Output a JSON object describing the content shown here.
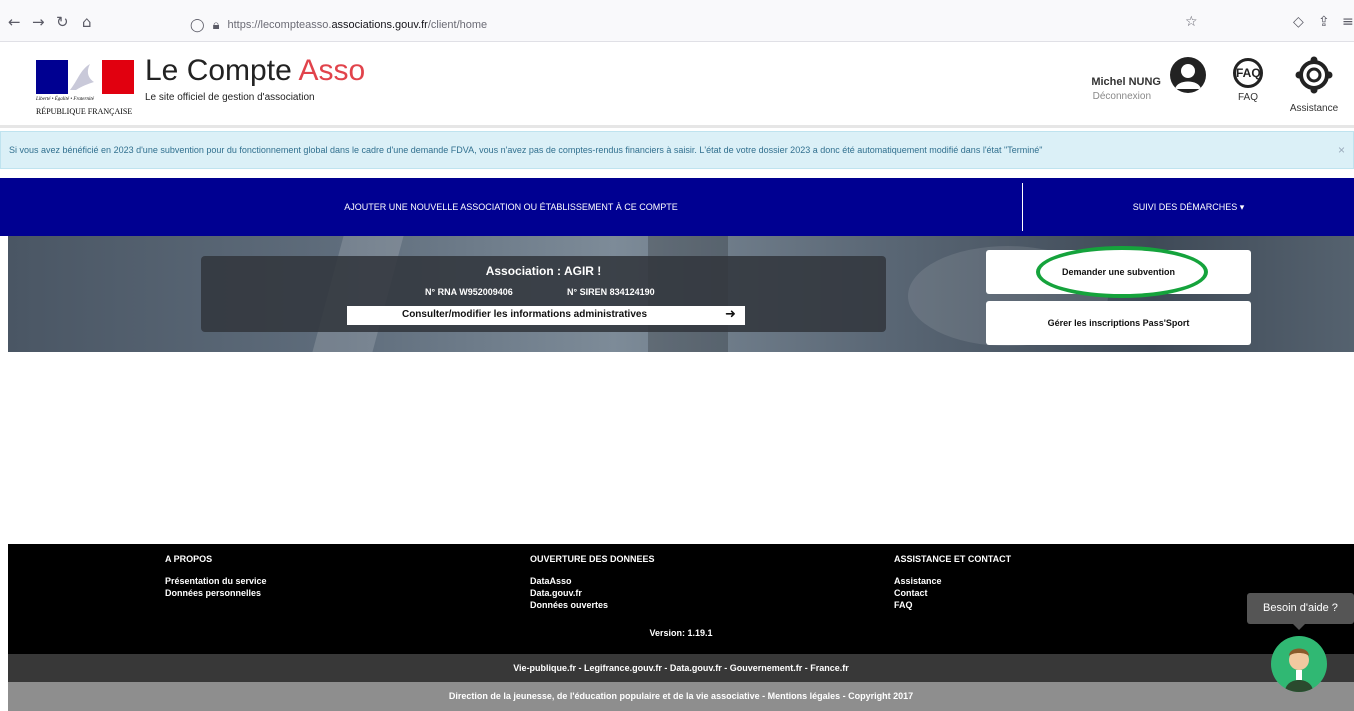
{
  "browser": {
    "url_prefix": "https://lecompteasso.",
    "url_host": "associations.gouv.fr",
    "url_path": "/client/home"
  },
  "header": {
    "flag_motto": "Liberté • Égalité • Fraternité",
    "republique": "RÉPUBLIQUE FRANÇAISE",
    "title_part1": "Le Compte ",
    "title_part2": "Asso",
    "subtitle": "Le site officiel de gestion d'association",
    "user_name": "Michel NUNG",
    "logout": "Déconnexion",
    "faq_icon_text": "FAQ",
    "faq_label": "FAQ",
    "help_label": "Assistance"
  },
  "alert": {
    "text": "Si vous avez bénéficié en 2023 d'une subvention pour du fonctionnement global dans le cadre d'une demande FDVA, vous n'avez pas de comptes-rendus financiers à saisir. L'état de votre dossier 2023 a donc été automatiquement modifié dans l'état \"Terminé\"",
    "close": "×"
  },
  "navbar": {
    "add_assoc": "AJOUTER UNE NOUVELLE ASSOCIATION OU ÉTABLISSEMENT À CE COMPTE",
    "suivi": "SUIVI DES DÉMARCHES ▾"
  },
  "association": {
    "name": "Association : AGIR !",
    "rna": "N° RNA W952009406",
    "siren": "N° SIREN 834124190",
    "consult_label": "Consulter/modifier les informations administratives",
    "consult_arrow": "➜"
  },
  "actions": {
    "subvention": "Demander une subvention",
    "passsport": "Gérer les inscriptions Pass'Sport"
  },
  "footer": {
    "col1": {
      "title": "A PROPOS",
      "links": [
        "Présentation du service",
        "Données personnelles"
      ]
    },
    "col2": {
      "title": "OUVERTURE DES DONNEES",
      "links": [
        "DataAsso",
        "Data.gouv.fr",
        "Données ouvertes"
      ]
    },
    "col3": {
      "title": "ASSISTANCE ET CONTACT",
      "links": [
        "Assistance",
        "Contact",
        "FAQ"
      ]
    },
    "version": "Version: 1.19.1",
    "links_line": "Vie-publique.fr - Legifrance.gouv.fr - Data.gouv.fr - Gouvernement.fr - France.fr",
    "copyright": "Direction de la jeunesse, de l'éducation populaire et de la vie associative - Mentions légales - Copyright 2017"
  },
  "chat": {
    "tooltip": "Besoin d'aide ?"
  },
  "colors": {
    "navbar": "#000091",
    "asso_red": "#e1434b",
    "highlight": "#15a33c",
    "alert_bg": "#dbf0f7"
  }
}
